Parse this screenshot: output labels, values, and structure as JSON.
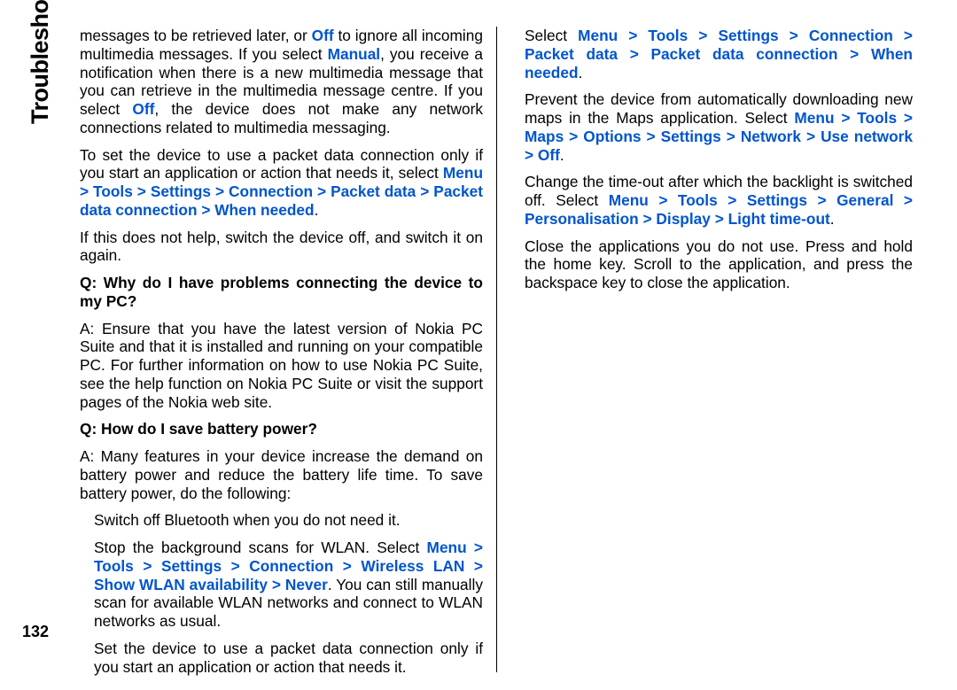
{
  "sideTitle": "Troubleshooting",
  "pageNumber": "132",
  "left": {
    "p1a": "messages to be retrieved later, or ",
    "p1_off": "Off",
    "p1b": " to ignore all incoming multimedia messages. If you select ",
    "p1_manual": "Manual",
    "p1c": ", you receive a notification when there is a new multimedia message that you can retrieve in the multimedia message centre. If you select ",
    "p1_off2": "Off",
    "p1d": ", the device does not make any network connections related to multimedia messaging.",
    "p2a": "To set the device to use a packet data connection only if you start an application or action that needs it, select ",
    "p2_path1": "Menu",
    "p2_path2": "Tools",
    "p2_path3": "Settings",
    "p2_path4": "Connection",
    "p2_path5": "Packet data",
    "p2_path6": "Packet data connection",
    "p2_path7": "When needed",
    "p2b": ".",
    "p3": "If this does not help, switch the device off, and switch it on again.",
    "q1": "Q: Why do I have problems connecting the device to my PC?",
    "a1": "A: Ensure that you have the latest version of Nokia PC Suite and that it is installed and running on your compatible PC. For further information on how to use Nokia PC Suite, see the help function on Nokia PC Suite or visit the support pages of the Nokia web site.",
    "q2": "Q: How do I save battery power?",
    "a2": "A: Many features in your device increase the demand on battery power and reduce the battery life time. To save battery power, do the following:",
    "a2_b1": "Switch off Bluetooth when you do not need it.",
    "a2_b2a": "Stop the background scans for WLAN. Select ",
    "a2_b2_path1": "Menu",
    "a2_b2_path2": "Tools",
    "a2_b2_path3": "Settings",
    "a2_b2_path4": "Connection",
    "a2_b2_path5": "Wireless LAN",
    "a2_b2_path6": "Show WLAN availability",
    "a2_b2_path7": "Never",
    "a2_b2b": ". You can still manually scan for available WLAN networks and connect to WLAN networks as usual.",
    "a2_b3": "Set the device to use a packet data connection only if you start an application or action that needs it."
  },
  "right": {
    "p1a": "Select ",
    "p1_path1": "Menu",
    "p1_path2": "Tools",
    "p1_path3": "Settings",
    "p1_path4": "Connection",
    "p1_path5": "Packet data",
    "p1_path6": "Packet data connection",
    "p1_path7": "When needed",
    "p1b": ".",
    "p2a": "Prevent the device from automatically downloading new maps in the Maps application. Select ",
    "p2_path1": "Menu",
    "p2_path2": "Tools",
    "p2_path3": "Maps",
    "p2_path4": "Options",
    "p2_path5": "Settings",
    "p2_path6": "Network",
    "p2_path7": "Use network",
    "p2_path8": "Off",
    "p2b": ".",
    "p3a": "Change the time-out after which the backlight is switched off. Select ",
    "p3_path1": "Menu",
    "p3_path2": "Tools",
    "p3_path3": "Settings",
    "p3_path4": "General",
    "p3_path5": "Personalisation",
    "p3_path6": "Display",
    "p3_path7": "Light time-out",
    "p3b": ".",
    "p4": "Close the applications you do not use. Press and hold the home key. Scroll to the application, and press the backspace key to close the application."
  },
  "gt": " > "
}
